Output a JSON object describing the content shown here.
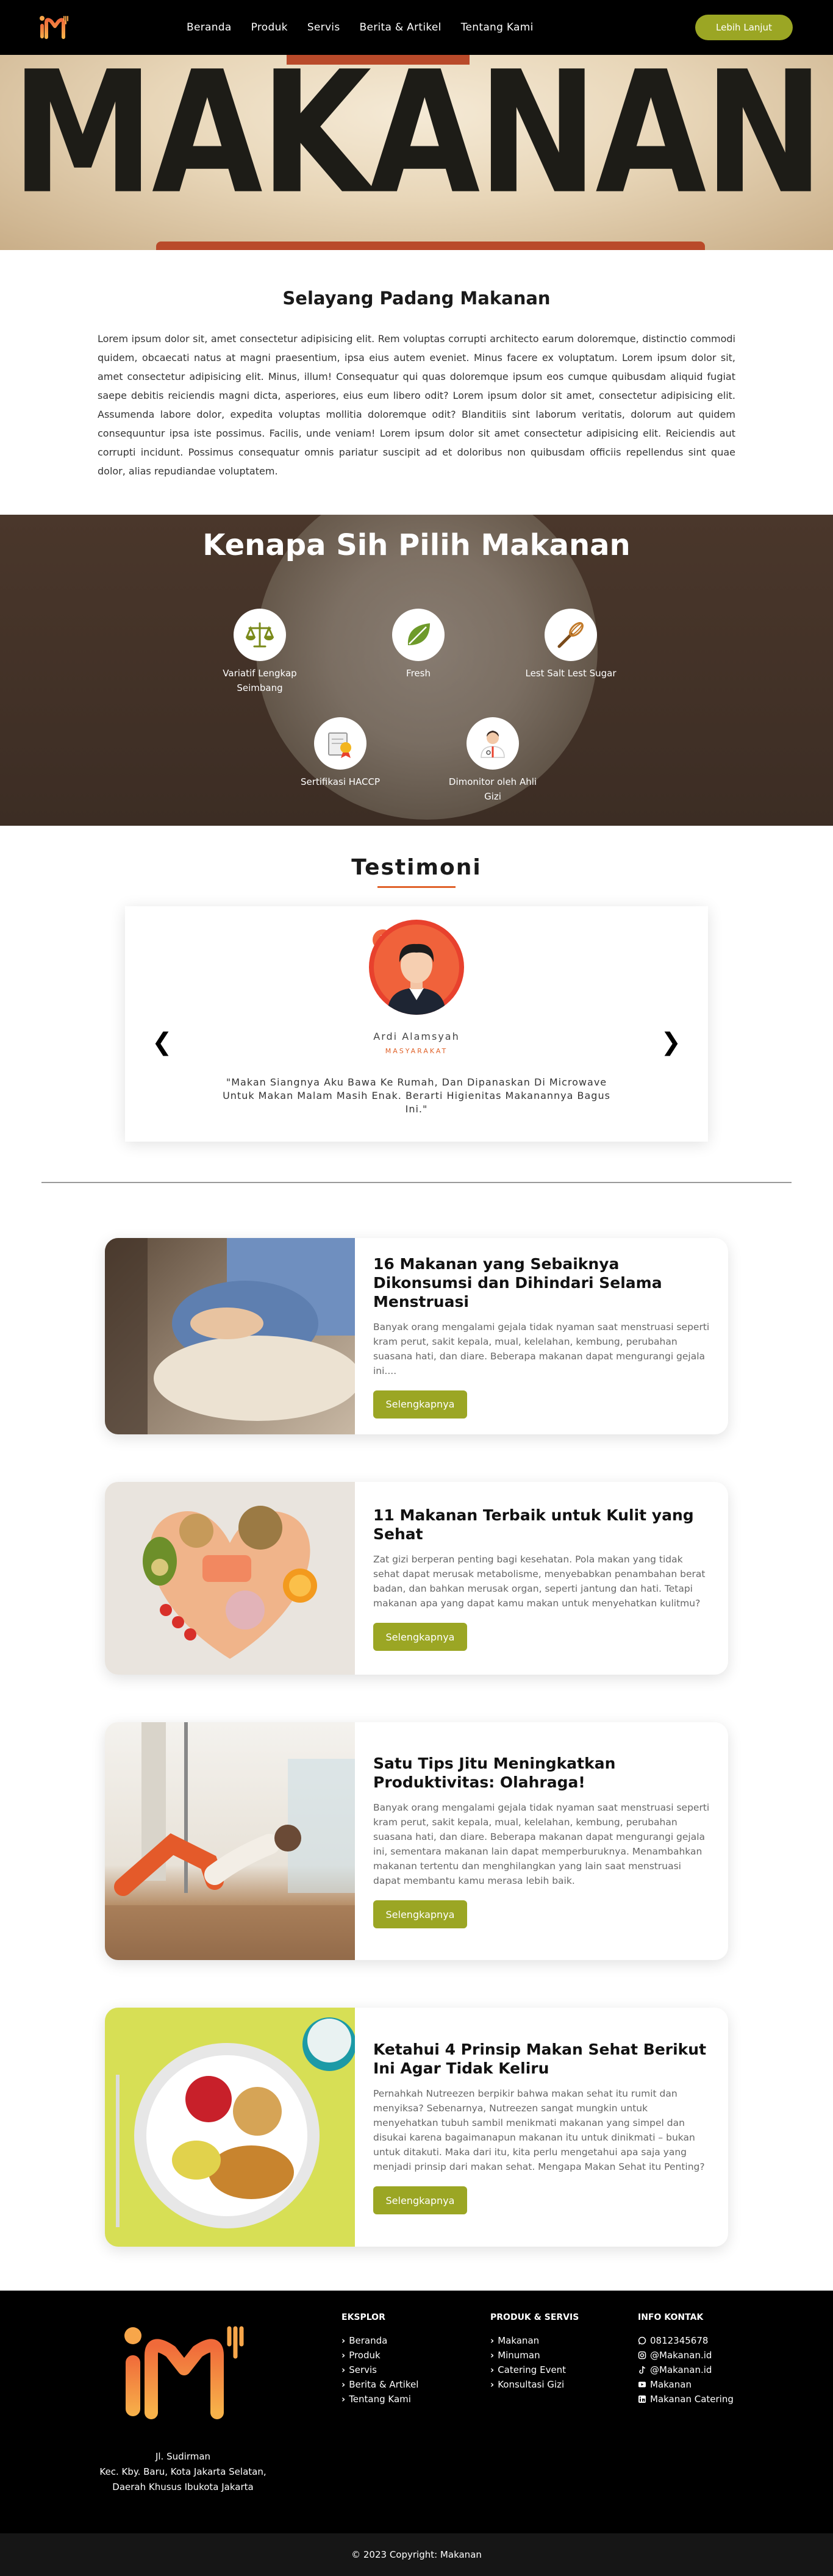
{
  "nav": {
    "links": [
      "Beranda",
      "Produk",
      "Servis",
      "Berita & Artikel",
      "Tentang Kami"
    ],
    "cta": "Lebih Lanjut"
  },
  "hero": {
    "word": "MAKANAN"
  },
  "about": {
    "title": "Selayang Padang Makanan",
    "text": "Lorem ipsum dolor sit, amet consectetur adipisicing elit. Rem voluptas corrupti architecto earum doloremque, distinctio commodi quidem, obcaecati natus at magni praesentium, ipsa eius autem eveniet. Minus facere ex voluptatum. Lorem ipsum dolor sit, amet consectetur adipisicing elit. Minus, illum! Consequatur qui quas doloremque ipsum eos cumque quibusdam aliquid fugiat saepe debitis reiciendis magni dicta, asperiores, eius eum libero odit? Lorem ipsum dolor sit amet, consectetur adipisicing elit. Assumenda labore dolor, expedita voluptas mollitia doloremque odit? Blanditiis sint laborum veritatis, dolorum aut quidem consequuntur ipsa iste possimus. Facilis, unde veniam! Lorem ipsum dolor sit amet consectetur adipisicing elit. Reiciendis aut corrupti incidunt. Possimus consequatur omnis pariatur suscipit ad et doloribus non quibusdam officiis repellendus sint quae dolor, alias repudiandae voluptatem."
  },
  "why": {
    "title": "Kenapa Sih Pilih Makanan",
    "features": [
      {
        "label": "Variatif Lengkap Seimbang",
        "icon": "scale-icon"
      },
      {
        "label": "Fresh",
        "icon": "leaf-icon"
      },
      {
        "label": "Lest Salt Lest Sugar",
        "icon": "whisk-icon"
      },
      {
        "label": "Sertifikasi HACCP",
        "icon": "certificate-icon"
      },
      {
        "label": "Dimonitor oleh Ahli Gizi",
        "icon": "nutritionist-icon"
      }
    ]
  },
  "testimoni": {
    "title": "Testimoni",
    "name": "Ardi Alamsyah",
    "role": "MASYARAKAT",
    "quote": "\"Makan Siangnya Aku Bawa Ke Rumah, Dan Dipanaskan Di Microwave Untuk Makan Malam Masih Enak. Berarti Higienitas Makanannya Bagus Ini.\"",
    "quote_mark": "”",
    "prev": "❮",
    "next": "❯"
  },
  "articles": [
    {
      "title": "16 Makanan yang Sebaiknya Dikonsumsi dan Dihindari Selama Menstruasi",
      "text": "Banyak orang mengalami gejala tidak nyaman saat menstruasi seperti kram perut, sakit kepala, mual, kelelahan, kembung, perubahan suasana hati, dan diare. Beberapa makanan dapat mengurangi gejala ini....",
      "button": "Selengkapnya"
    },
    {
      "title": "11 Makanan Terbaik untuk Kulit yang Sehat",
      "text": "Zat gizi berperan penting bagi kesehatan. Pola makan yang tidak sehat dapat merusak metabolisme, menyebabkan penambahan berat badan, dan bahkan merusak organ, seperti jantung dan hati. Tetapi makanan apa yang dapat kamu makan untuk menyehatkan kulitmu?",
      "button": "Selengkapnya"
    },
    {
      "title": "Satu Tips Jitu Meningkatkan Produktivitas: Olahraga!",
      "text": "Banyak orang mengalami gejala tidak nyaman saat menstruasi seperti kram perut, sakit kepala, mual, kelelahan, kembung, perubahan suasana hati, dan diare. Beberapa makanan dapat mengurangi gejala ini, sementara makanan lain dapat memperburuknya. Menambahkan makanan tertentu dan menghilangkan yang lain saat menstruasi dapat membantu kamu merasa lebih baik.",
      "button": "Selengkapnya"
    },
    {
      "title": "Ketahui 4 Prinsip Makan Sehat Berikut Ini Agar Tidak Keliru",
      "text": "Pernahkah Nutreezen berpikir bahwa makan sehat itu rumit dan menyiksa? Sebenarnya, Nutreezen sangat mungkin untuk menyehatkan tubuh sambil menikmati makanan yang simpel dan disukai karena bagaimanapun makanan itu untuk dinikmati – bukan untuk ditakuti. Maka dari itu, kita perlu mengetahui apa saja yang menjadi prinsip dari makan sehat. Mengapa Makan Sehat itu Penting?",
      "button": "Selengkapnya"
    }
  ],
  "footer": {
    "address": [
      "Jl. Sudirman",
      "Kec. Kby. Baru, Kota Jakarta Selatan,",
      "Daerah Khusus Ibukota Jakarta"
    ],
    "eksplor_title": "EKSPLOR",
    "eksplor": [
      "Beranda",
      "Produk",
      "Servis",
      "Berita & Artikel",
      "Tentang Kami"
    ],
    "produk_title": "PRODUK & SERVIS",
    "produk": [
      "Makanan",
      "Minuman",
      "Catering Event",
      "Konsultasi Gizi"
    ],
    "kontak_title": "INFO KONTAK",
    "kontak": [
      {
        "icon": "whatsapp-icon",
        "text": "0812345678"
      },
      {
        "icon": "instagram-icon",
        "text": "@Makanan.id"
      },
      {
        "icon": "tiktok-icon",
        "text": "@Makanan.id"
      },
      {
        "icon": "youtube-icon",
        "text": "Makanan"
      },
      {
        "icon": "linkedin-icon",
        "text": "Makanan Catering"
      }
    ],
    "copyright": "© 2023 Copyright: Makanan",
    "chevron": "›"
  },
  "colors": {
    "accent": "#9ba624",
    "orange": "#e0622a",
    "dark": "#000000"
  }
}
